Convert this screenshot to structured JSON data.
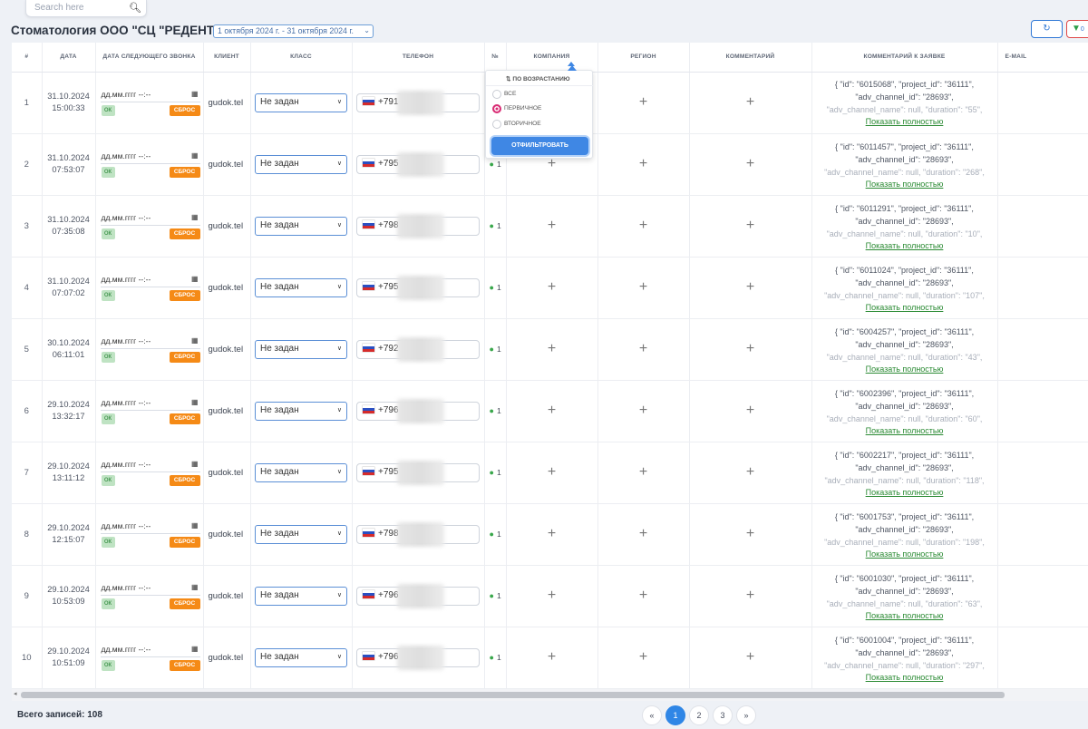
{
  "search": {
    "placeholder": "Search here"
  },
  "header": {
    "title": "Стоматология ООО \"СЦ \"РЕДЕНТ\"",
    "date_range": "1 октября 2024 г. - 31 октября 2024 г.",
    "filter_count": "0"
  },
  "columns": [
    "#",
    "Дата",
    "Дата следующего звонка",
    "Клиент",
    "Класс",
    "Телефон",
    "№",
    "Компания",
    "Регион",
    "Комментарий",
    "Комментарий к заявке",
    "E-mail"
  ],
  "date_placeholder": "дд.мм.гггг --:--",
  "ok_label": "ОК",
  "reset_label": "СБРОС",
  "class_default": "Не задан",
  "show_full": "Показать полностью",
  "rows": [
    {
      "n": "1",
      "date": "31.10.2024",
      "time": "15:00:33",
      "client": "gudok.tel",
      "phone": "+791",
      "no": "",
      "c1": "{ \"id\": \"6015068\", \"project_id\": \"36111\",",
      "c2": "\"adv_channel_id\": \"28693\",",
      "c3": "\"adv_channel_name\": null, \"duration\": \"55\","
    },
    {
      "n": "2",
      "date": "31.10.2024",
      "time": "07:53:07",
      "client": "gudok.tel",
      "phone": "+795",
      "no": "1",
      "c1": "{ \"id\": \"6011457\", \"project_id\": \"36111\",",
      "c2": "\"adv_channel_id\": \"28693\",",
      "c3": "\"adv_channel_name\": null, \"duration\": \"268\","
    },
    {
      "n": "3",
      "date": "31.10.2024",
      "time": "07:35:08",
      "client": "gudok.tel",
      "phone": "+798",
      "no": "1",
      "c1": "{ \"id\": \"6011291\", \"project_id\": \"36111\",",
      "c2": "\"adv_channel_id\": \"28693\",",
      "c3": "\"adv_channel_name\": null, \"duration\": \"10\","
    },
    {
      "n": "4",
      "date": "31.10.2024",
      "time": "07:07:02",
      "client": "gudok.tel",
      "phone": "+795",
      "no": "1",
      "c1": "{ \"id\": \"6011024\", \"project_id\": \"36111\",",
      "c2": "\"adv_channel_id\": \"28693\",",
      "c3": "\"adv_channel_name\": null, \"duration\": \"107\","
    },
    {
      "n": "5",
      "date": "30.10.2024",
      "time": "06:11:01",
      "client": "gudok.tel",
      "phone": "+792",
      "no": "1",
      "c1": "{ \"id\": \"6004257\", \"project_id\": \"36111\",",
      "c2": "\"adv_channel_id\": \"28693\",",
      "c3": "\"adv_channel_name\": null, \"duration\": \"43\","
    },
    {
      "n": "6",
      "date": "29.10.2024",
      "time": "13:32:17",
      "client": "gudok.tel",
      "phone": "+796",
      "no": "1",
      "c1": "{ \"id\": \"6002396\", \"project_id\": \"36111\",",
      "c2": "\"adv_channel_id\": \"28693\",",
      "c3": "\"adv_channel_name\": null, \"duration\": \"60\","
    },
    {
      "n": "7",
      "date": "29.10.2024",
      "time": "13:11:12",
      "client": "gudok.tel",
      "phone": "+795",
      "no": "1",
      "c1": "{ \"id\": \"6002217\", \"project_id\": \"36111\",",
      "c2": "\"adv_channel_id\": \"28693\",",
      "c3": "\"adv_channel_name\": null, \"duration\": \"118\","
    },
    {
      "n": "8",
      "date": "29.10.2024",
      "time": "12:15:07",
      "client": "gudok.tel",
      "phone": "+798",
      "no": "1",
      "c1": "{ \"id\": \"6001753\", \"project_id\": \"36111\",",
      "c2": "\"adv_channel_id\": \"28693\",",
      "c3": "\"adv_channel_name\": null, \"duration\": \"198\","
    },
    {
      "n": "9",
      "date": "29.10.2024",
      "time": "10:53:09",
      "client": "gudok.tel",
      "phone": "+796",
      "no": "1",
      "c1": "{ \"id\": \"6001030\", \"project_id\": \"36111\",",
      "c2": "\"adv_channel_id\": \"28693\",",
      "c3": "\"adv_channel_name\": null, \"duration\": \"63\","
    },
    {
      "n": "10",
      "date": "29.10.2024",
      "time": "10:51:09",
      "client": "gudok.tel",
      "phone": "+796",
      "no": "1",
      "c1": "{ \"id\": \"6001004\", \"project_id\": \"36111\",",
      "c2": "\"adv_channel_id\": \"28693\",",
      "c3": "\"adv_channel_name\": null, \"duration\": \"297\","
    }
  ],
  "popup": {
    "sort_label": "По возрастанию",
    "options": [
      "Все",
      "Первичное",
      "Вторичное"
    ],
    "selected": "Первичное",
    "apply_label": "Отфильтровать"
  },
  "footer": {
    "total": "Всего записей: 108",
    "pages": [
      "«",
      "1",
      "2",
      "3",
      "»"
    ],
    "current_page": "1"
  }
}
